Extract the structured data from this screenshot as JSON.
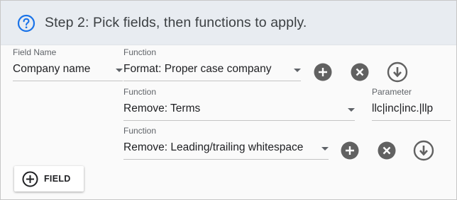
{
  "header": {
    "title": "Step 2: Pick fields, then functions to apply."
  },
  "row1": {
    "field_caption": "Field Name",
    "field_value": "Company name",
    "function_caption": "Function",
    "function_value": "Format: Proper case company"
  },
  "row2": {
    "function_caption": "Function",
    "function_value": "Remove: Terms",
    "parameter_caption": "Parameter",
    "parameter_value": "llc|inc|inc.|llp"
  },
  "row3": {
    "function_caption": "Function",
    "function_value": "Remove: Leading/trailing whitespace"
  },
  "add_field_button": {
    "label": "FIELD"
  },
  "icons": {
    "help": "help-circle-icon",
    "add": "add-circle-icon",
    "remove": "cancel-circle-icon",
    "move_down": "arrow-down-circle-icon"
  },
  "colors": {
    "accent": "#1a73e8",
    "icon_gray": "#616161",
    "header_bg": "#e8ecf1"
  }
}
